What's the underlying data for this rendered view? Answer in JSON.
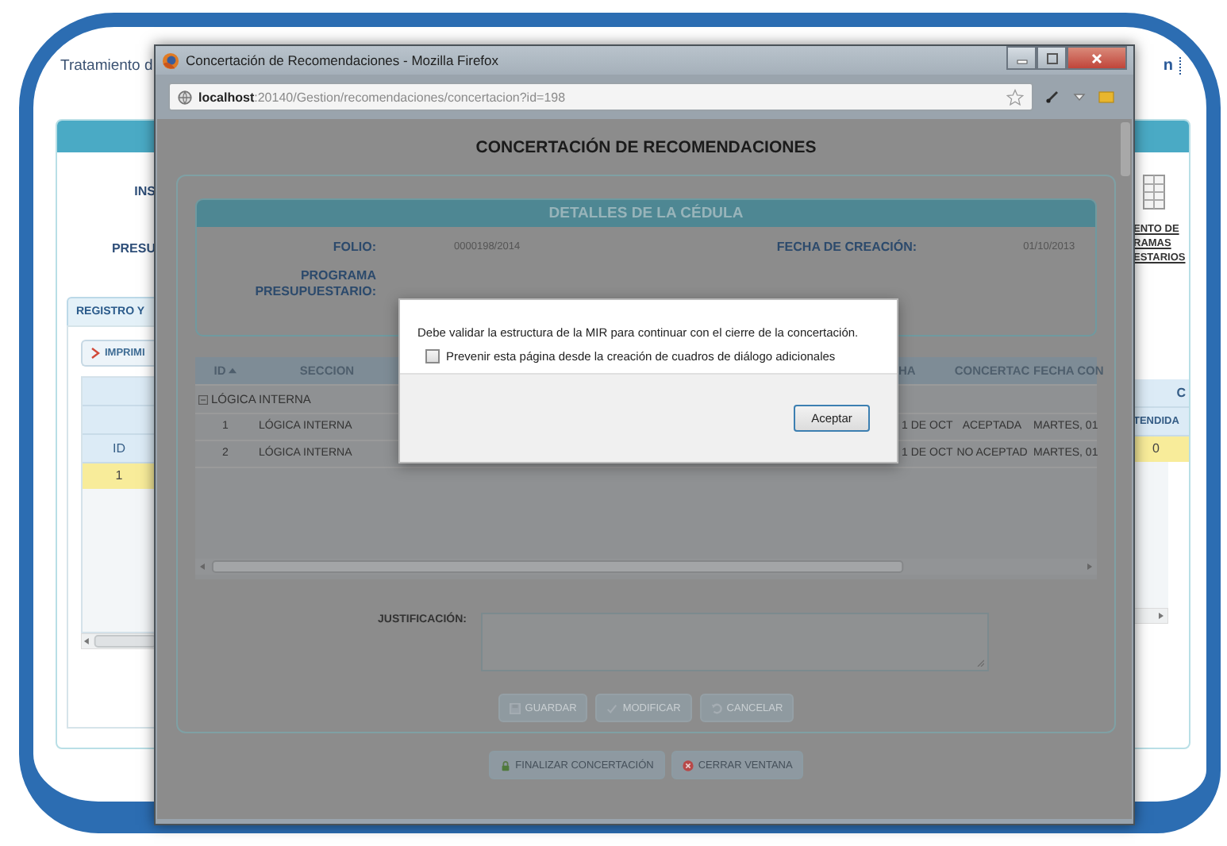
{
  "background_page": {
    "title": "Tratamiento d",
    "menu_tail": "n",
    "labels": [
      "INS",
      "PRESU"
    ],
    "report_link": [
      "ENTO DE",
      "RAMAS",
      "ESTARIOS"
    ],
    "tab": "REGISTRO Y",
    "print_button": "IMPRIMI",
    "left_table": {
      "column": "ID",
      "rows": [
        {
          "cell": "1",
          "selected": true
        }
      ]
    },
    "right_table": {
      "group_header": "C",
      "column": "TENDIDA",
      "rows": [
        {
          "cell": "0",
          "selected": true
        }
      ]
    }
  },
  "browser_window": {
    "title": "Concertación de Recomendaciones - Mozilla Firefox",
    "url": "**localhost**:20140/Gestion/recomendaciones/concertacion?id=198"
  },
  "page": {
    "heading": "CONCERTACIÓN DE RECOMENDACIONES",
    "details": {
      "title": "DETALLES DE LA CÉDULA",
      "fields": [
        {
          "label": "FOLIO:",
          "value": "0000198/2014"
        },
        {
          "label": "FECHA DE CREACIÓN:",
          "value": "01/10/2013"
        }
      ],
      "program_label": "PROGRAMA PRESUPUESTARIO:"
    },
    "grid": {
      "columns": [
        {
          "label": "ID",
          "sorted": true
        },
        {
          "label": "SECCION",
          "sorted": false
        },
        {
          "label": "HA",
          "sorted": false
        },
        {
          "label": "CONCERTAC",
          "sorted": false
        },
        {
          "label": "FECHA CON",
          "sorted": false
        }
      ],
      "group": {
        "label": "LÓGICA INTERNA",
        "expanded": true
      },
      "rows": [
        {
          "cells": [
            "1",
            "LÓGICA INTERNA",
            "1 DE OCT",
            "ACEPTADA",
            "MARTES, 01"
          ]
        },
        {
          "cells": [
            "2",
            "LÓGICA INTERNA",
            "1 DE OCT",
            "NO ACEPTAD",
            "MARTES, 01"
          ]
        }
      ]
    },
    "justification_label": "JUSTIFICACIÓN:",
    "actions": [
      {
        "label": "GUARDAR",
        "kind": "save",
        "disabled": true
      },
      {
        "label": "MODIFICAR",
        "kind": "check",
        "disabled": true
      },
      {
        "label": "CANCELAR",
        "kind": "undo",
        "disabled": true
      }
    ],
    "footer_actions": [
      {
        "label": "FINALIZAR CONCERTACIÓN",
        "kind": "lock"
      },
      {
        "label": "CERRAR VENTANA",
        "kind": "close"
      }
    ],
    "dialog": {
      "message": "Debe validar la estructura de la MIR para continuar con el cierre de la concertación.",
      "checkbox": {
        "label": "Prevenir esta página desde la creación de cuadros de diálogo adicionales",
        "checked": false
      },
      "button": "Aceptar"
    }
  }
}
